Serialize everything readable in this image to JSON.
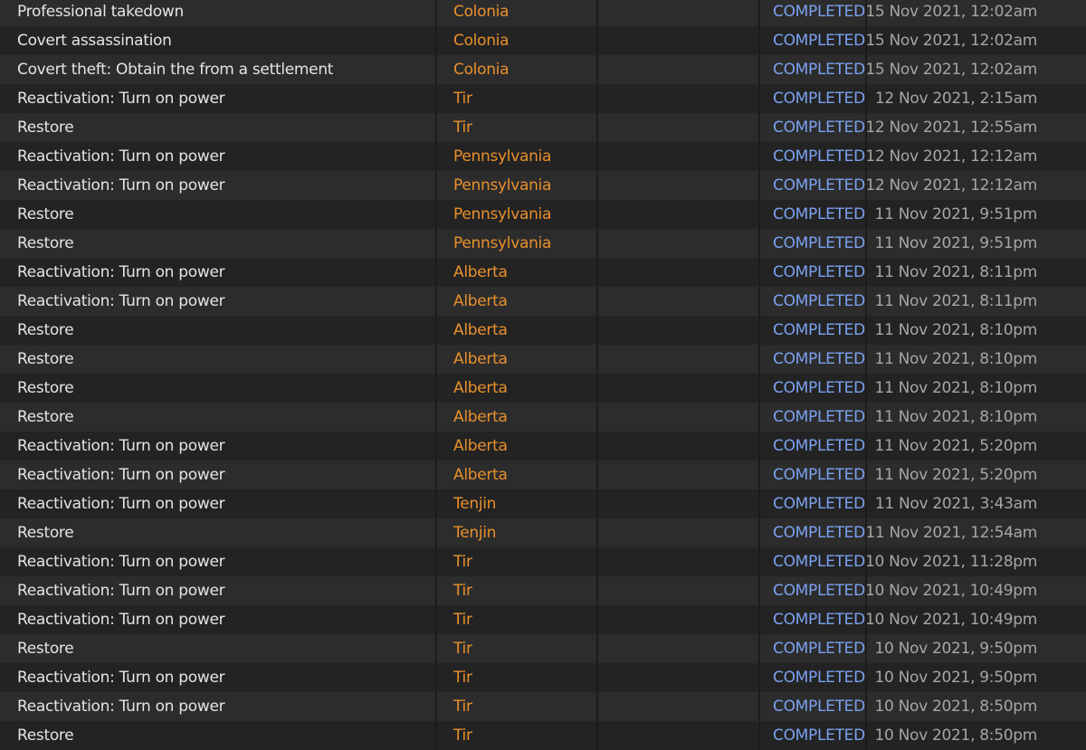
{
  "colors": {
    "row_odd": "#2c2c2c",
    "row_even": "#232323",
    "task_text": "#e4e4e4",
    "location_text": "#e8902c",
    "status_text": "#7ba1f0",
    "date_text": "#a6a6a6"
  },
  "rows": [
    {
      "task": "Professional takedown",
      "location": "Colonia",
      "status": "COMPLETED",
      "date": "15 Nov 2021, 12:02am"
    },
    {
      "task": "Covert assassination",
      "location": "Colonia",
      "status": "COMPLETED",
      "date": "15 Nov 2021, 12:02am"
    },
    {
      "task": "Covert theft: Obtain the from a settlement",
      "location": "Colonia",
      "status": "COMPLETED",
      "date": "15 Nov 2021, 12:02am"
    },
    {
      "task": "Reactivation: Turn on power",
      "location": "Tir",
      "status": "COMPLETED",
      "date": "12 Nov 2021, 2:15am"
    },
    {
      "task": "Restore",
      "location": "Tir",
      "status": "COMPLETED",
      "date": "12 Nov 2021, 12:55am"
    },
    {
      "task": "Reactivation: Turn on power",
      "location": "Pennsylvania",
      "status": "COMPLETED",
      "date": "12 Nov 2021, 12:12am"
    },
    {
      "task": "Reactivation: Turn on power",
      "location": "Pennsylvania",
      "status": "COMPLETED",
      "date": "12 Nov 2021, 12:12am"
    },
    {
      "task": "Restore",
      "location": "Pennsylvania",
      "status": "COMPLETED",
      "date": "11 Nov 2021, 9:51pm"
    },
    {
      "task": "Restore",
      "location": "Pennsylvania",
      "status": "COMPLETED",
      "date": "11 Nov 2021, 9:51pm"
    },
    {
      "task": "Reactivation: Turn on power",
      "location": "Alberta",
      "status": "COMPLETED",
      "date": "11 Nov 2021, 8:11pm"
    },
    {
      "task": "Reactivation: Turn on power",
      "location": "Alberta",
      "status": "COMPLETED",
      "date": "11 Nov 2021, 8:11pm"
    },
    {
      "task": "Restore",
      "location": "Alberta",
      "status": "COMPLETED",
      "date": "11 Nov 2021, 8:10pm"
    },
    {
      "task": "Restore",
      "location": "Alberta",
      "status": "COMPLETED",
      "date": "11 Nov 2021, 8:10pm"
    },
    {
      "task": "Restore",
      "location": "Alberta",
      "status": "COMPLETED",
      "date": "11 Nov 2021, 8:10pm"
    },
    {
      "task": "Restore",
      "location": "Alberta",
      "status": "COMPLETED",
      "date": "11 Nov 2021, 8:10pm"
    },
    {
      "task": "Reactivation: Turn on power",
      "location": "Alberta",
      "status": "COMPLETED",
      "date": "11 Nov 2021, 5:20pm"
    },
    {
      "task": "Reactivation: Turn on power",
      "location": "Alberta",
      "status": "COMPLETED",
      "date": "11 Nov 2021, 5:20pm"
    },
    {
      "task": "Reactivation: Turn on power",
      "location": "Tenjin",
      "status": "COMPLETED",
      "date": "11 Nov 2021, 3:43am"
    },
    {
      "task": "Restore",
      "location": "Tenjin",
      "status": "COMPLETED",
      "date": "11 Nov 2021, 12:54am"
    },
    {
      "task": "Reactivation: Turn on power",
      "location": "Tir",
      "status": "COMPLETED",
      "date": "10 Nov 2021, 11:28pm"
    },
    {
      "task": "Reactivation: Turn on power",
      "location": "Tir",
      "status": "COMPLETED",
      "date": "10 Nov 2021, 10:49pm"
    },
    {
      "task": "Reactivation: Turn on power",
      "location": "Tir",
      "status": "COMPLETED",
      "date": "10 Nov 2021, 10:49pm"
    },
    {
      "task": "Restore",
      "location": "Tir",
      "status": "COMPLETED",
      "date": "10 Nov 2021, 9:50pm"
    },
    {
      "task": "Reactivation: Turn on power",
      "location": "Tir",
      "status": "COMPLETED",
      "date": "10 Nov 2021, 9:50pm"
    },
    {
      "task": "Reactivation: Turn on power",
      "location": "Tir",
      "status": "COMPLETED",
      "date": "10 Nov 2021, 8:50pm"
    },
    {
      "task": "Restore",
      "location": "Tir",
      "status": "COMPLETED",
      "date": "10 Nov 2021, 8:50pm"
    }
  ]
}
